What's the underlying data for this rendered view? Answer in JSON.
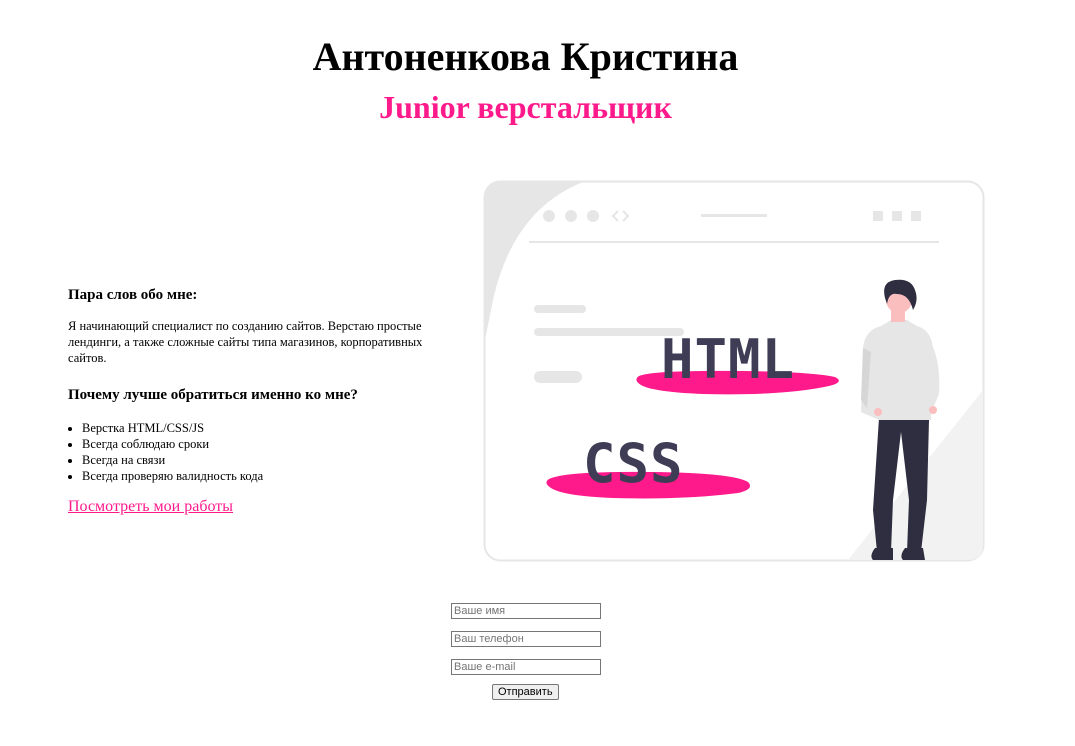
{
  "header": {
    "name": "Антоненкова Кристина",
    "role": "Junior верстальщик"
  },
  "about": {
    "heading": "Пара слов обо мне:",
    "text": "Я начинающий специалист по созданию сайтов. Верстаю простые лендинги, а также сложные сайты типа магазинов, корпоративных сайтов.",
    "why_heading": "Почему лучше обратиться именно ко мне?",
    "reasons": [
      "Верстка HTML/CSS/JS",
      "Всегда соблюдаю сроки",
      "Всегда на связи",
      "Всегда проверяю валидность кода"
    ],
    "works_link": "Посмотреть мои работы"
  },
  "illustration": {
    "label_html": "HTML",
    "label_css": "CSS"
  },
  "form": {
    "name_placeholder": "Ваше имя",
    "phone_placeholder": "Ваш телефон",
    "email_placeholder": "Ваше e-mail",
    "submit_label": "Отправить"
  },
  "colors": {
    "accent": "#ff1a8c",
    "text": "#000000",
    "illustration_dark": "#3f3d56",
    "illustration_light": "#e6e6e6"
  }
}
